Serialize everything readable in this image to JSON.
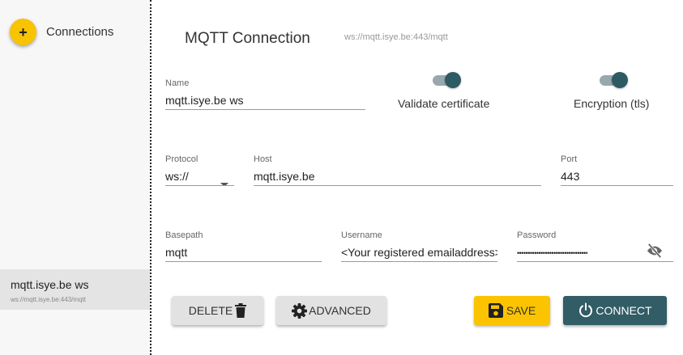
{
  "sidebar": {
    "add_button_symbol": "+",
    "header_label": "Connections",
    "items": [
      {
        "name": "mqtt.isye.be ws",
        "url": "ws://mqtt.isye.be:443/mqtt"
      }
    ]
  },
  "header": {
    "title": "MQTT Connection",
    "url": "ws://mqtt.isye.be:443/mqtt"
  },
  "form": {
    "name": {
      "label": "Name",
      "value": "mqtt.isye.be ws"
    },
    "validate_certificate": {
      "label": "Validate certificate",
      "enabled": true
    },
    "encryption": {
      "label": "Encryption (tls)",
      "enabled": true
    },
    "protocol": {
      "label": "Protocol",
      "value": "ws://"
    },
    "host": {
      "label": "Host",
      "value": "mqtt.isye.be"
    },
    "port": {
      "label": "Port",
      "value": "443"
    },
    "basepath": {
      "label": "Basepath",
      "value": "mqtt"
    },
    "username": {
      "label": "Username",
      "value": "<Your registered emailaddress>"
    },
    "password": {
      "label": "Password",
      "value": "•••••••••••••••••••••••••••••••••"
    }
  },
  "actions": {
    "delete_label": "DELETE",
    "advanced_label": "ADVANCED",
    "save_label": "SAVE",
    "connect_label": "CONNECT"
  },
  "icons": {
    "add": "plus-icon",
    "visibility": "eye-off-icon",
    "delete": "trash-icon",
    "advanced": "gear-icon",
    "save": "floppy-disk-icon",
    "connect": "power-icon",
    "protocol_dropdown": "caret-down-icon"
  },
  "colors": {
    "accent_yellow": "#fcc400",
    "primary_dark": "#325c66",
    "toggle_track": "#98a8ad",
    "toggle_thumb": "#2e5a63",
    "sidebar_bg": "#f7f7f7",
    "selected_item_bg": "#e4e4e4"
  }
}
